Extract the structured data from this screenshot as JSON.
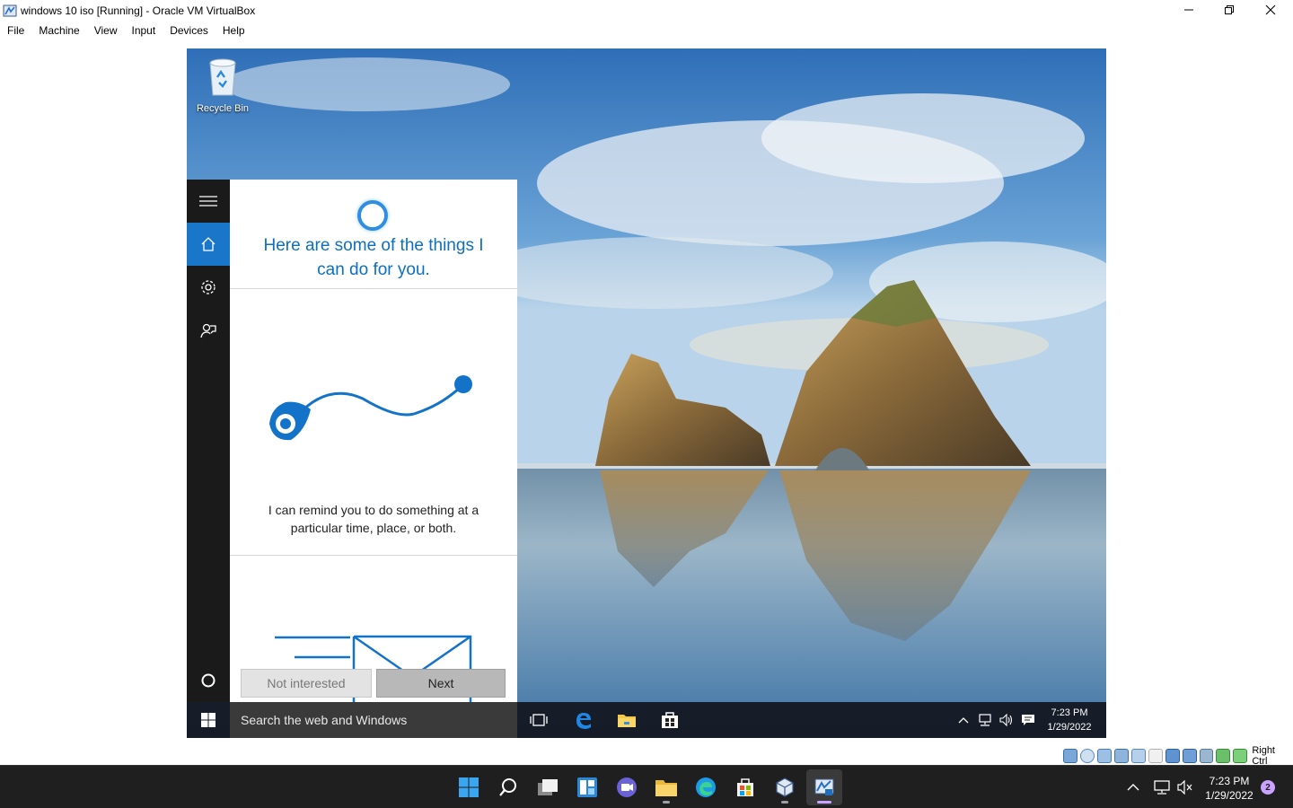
{
  "window": {
    "title": "windows 10 iso [Running] - Oracle VM VirtualBox",
    "menu": [
      "File",
      "Machine",
      "View",
      "Input",
      "Devices",
      "Help"
    ]
  },
  "guest": {
    "desktop_icons": [
      {
        "label": "Recycle Bin",
        "icon": "recycle-bin-icon"
      }
    ],
    "cortana": {
      "rail_items": [
        "hamburger-icon",
        "home-icon",
        "settings-icon",
        "feedback-icon"
      ],
      "heading": "Here are some of the things I can do for you.",
      "card_text": "I can remind you to do something at a particular time, place, or both.",
      "not_interested_label": "Not interested",
      "next_label": "Next"
    },
    "taskbar": {
      "search_placeholder": "Search the web and Windows",
      "time": "7:23 PM",
      "date": "1/29/2022"
    }
  },
  "statusbar": {
    "host_key_label": "Right Ctrl"
  },
  "host_taskbar": {
    "time": "7:23 PM",
    "date": "1/29/2022",
    "notification_count": "2"
  },
  "colors": {
    "cortana_blue": "#0c6fbf",
    "rail_active": "#1976c8",
    "host_taskbar": "#1f1f1f"
  }
}
